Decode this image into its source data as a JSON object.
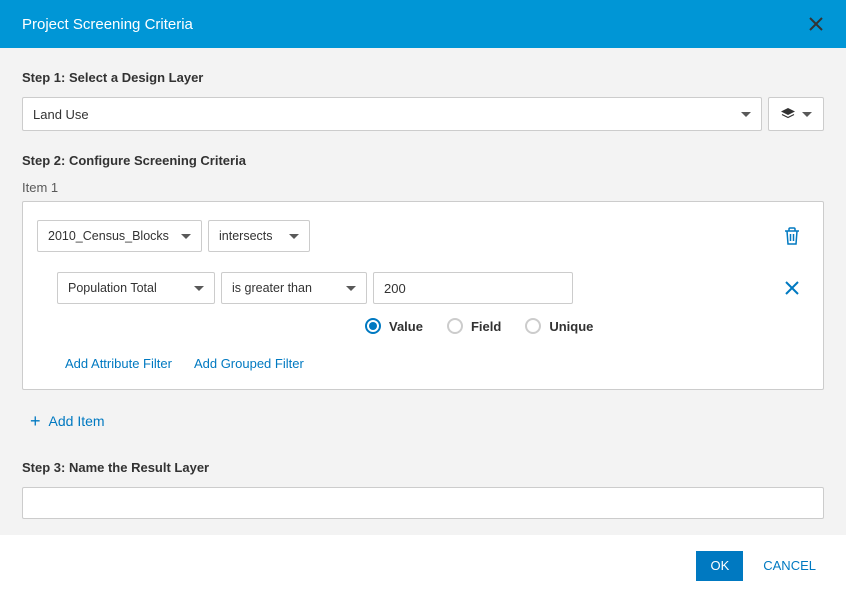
{
  "header": {
    "title": "Project Screening Criteria"
  },
  "step1": {
    "label": "Step 1: Select a Design Layer",
    "selected": "Land Use"
  },
  "step2": {
    "label": "Step 2: Configure Screening Criteria",
    "item_label": "Item 1",
    "layer": "2010_Census_Blocks",
    "spatial_op": "intersects",
    "filter": {
      "field": "Population Total",
      "comparator": "is greater than",
      "value": "200"
    },
    "radios": {
      "value": "Value",
      "field": "Field",
      "unique": "Unique"
    },
    "links": {
      "add_attribute": "Add Attribute Filter",
      "add_grouped": "Add Grouped Filter"
    },
    "add_item": "Add Item"
  },
  "step3": {
    "label": "Step 3: Name the Result Layer",
    "value": ""
  },
  "footer": {
    "ok": "OK",
    "cancel": "CANCEL"
  }
}
